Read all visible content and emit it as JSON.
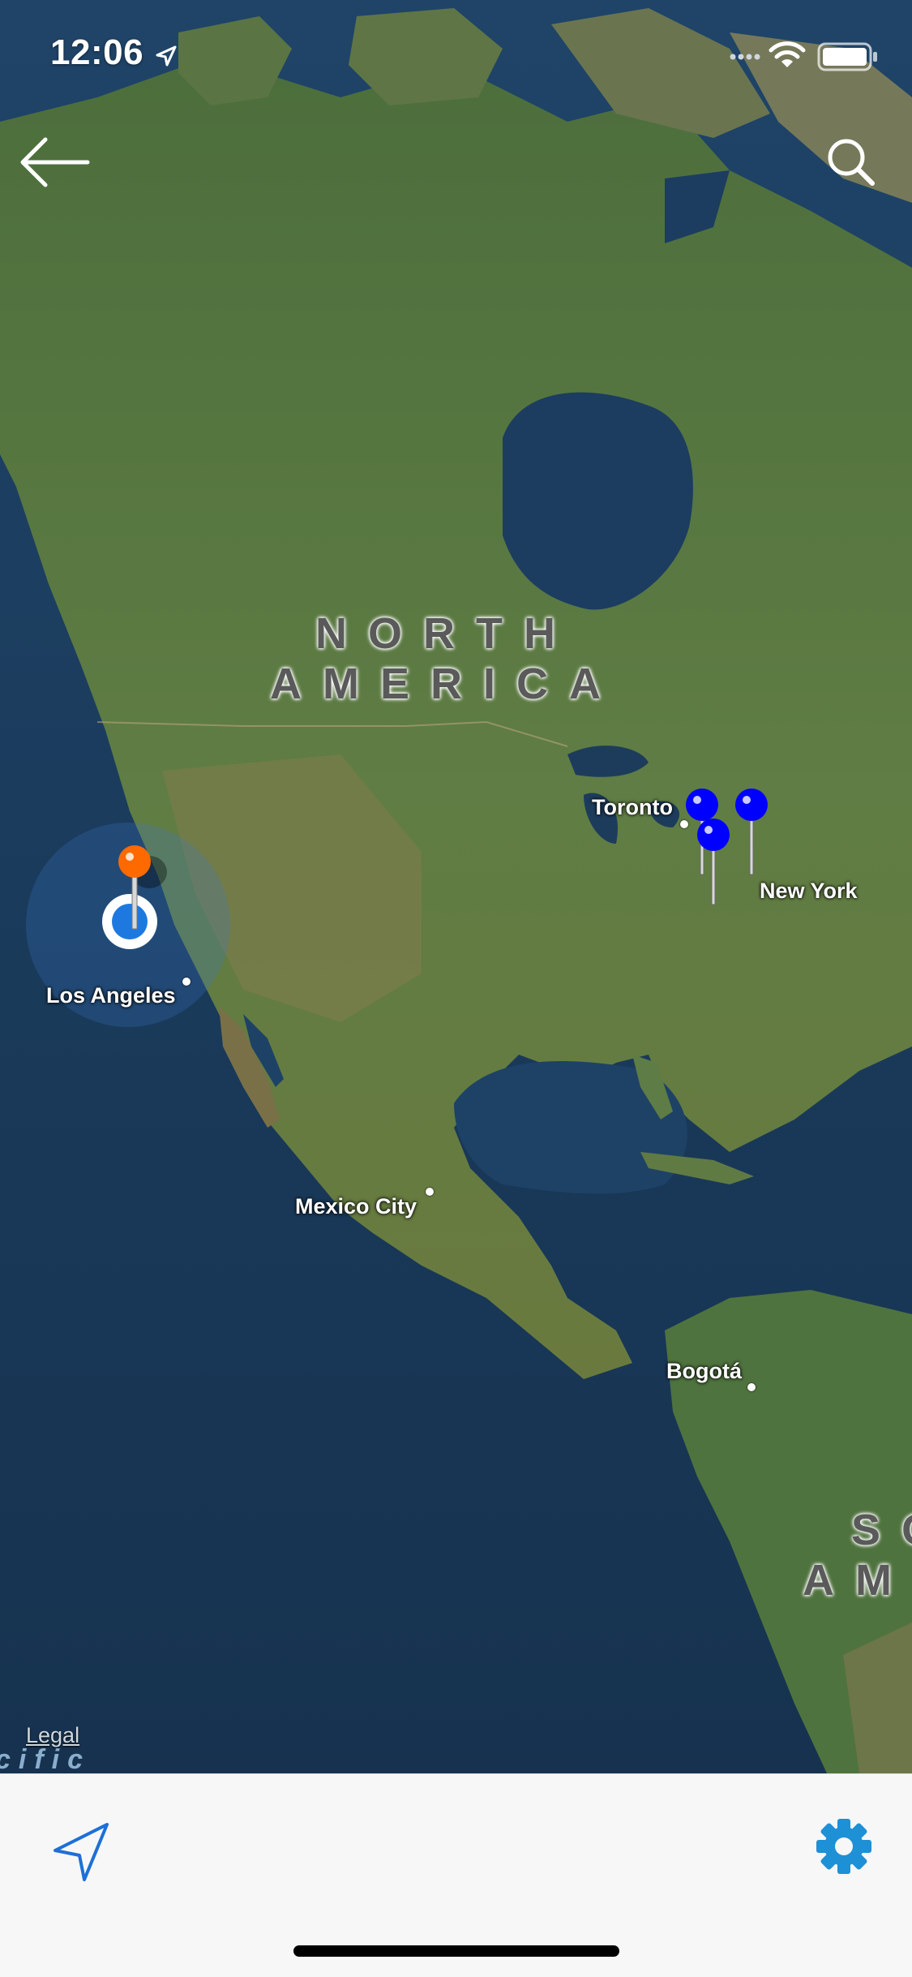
{
  "status_bar": {
    "time": "12:06",
    "icons": [
      "location-arrow-icon",
      "signal-icon",
      "wifi-icon",
      "battery-icon"
    ]
  },
  "top_bar": {
    "icons": [
      "back-arrow-icon",
      "search-icon"
    ]
  },
  "map": {
    "style": "satellite",
    "continent_labels": [
      {
        "line1": "NORTH",
        "line2": "AMERICA"
      },
      {
        "line1": "SO",
        "line2": "AM"
      }
    ],
    "cities": {
      "toronto": "Toronto",
      "new_york": "New York",
      "los_angeles": "Los Angeles",
      "mexico_city": "Mexico City",
      "bogota": "Bogotá"
    },
    "ocean_label_fragment": "cific",
    "legal": "Legal",
    "pins": [
      {
        "color": "#ff6a00",
        "place": "Los Angeles area"
      },
      {
        "color": "#0000ff",
        "place": "Toronto area"
      },
      {
        "color": "#0000ff",
        "place": "Toronto area"
      },
      {
        "color": "#0000ff",
        "place": "New York area"
      }
    ]
  },
  "bottom_toolbar": {
    "icons": [
      "navigation-arrow-icon",
      "gear-icon"
    ],
    "accent": "#1e90d6"
  }
}
